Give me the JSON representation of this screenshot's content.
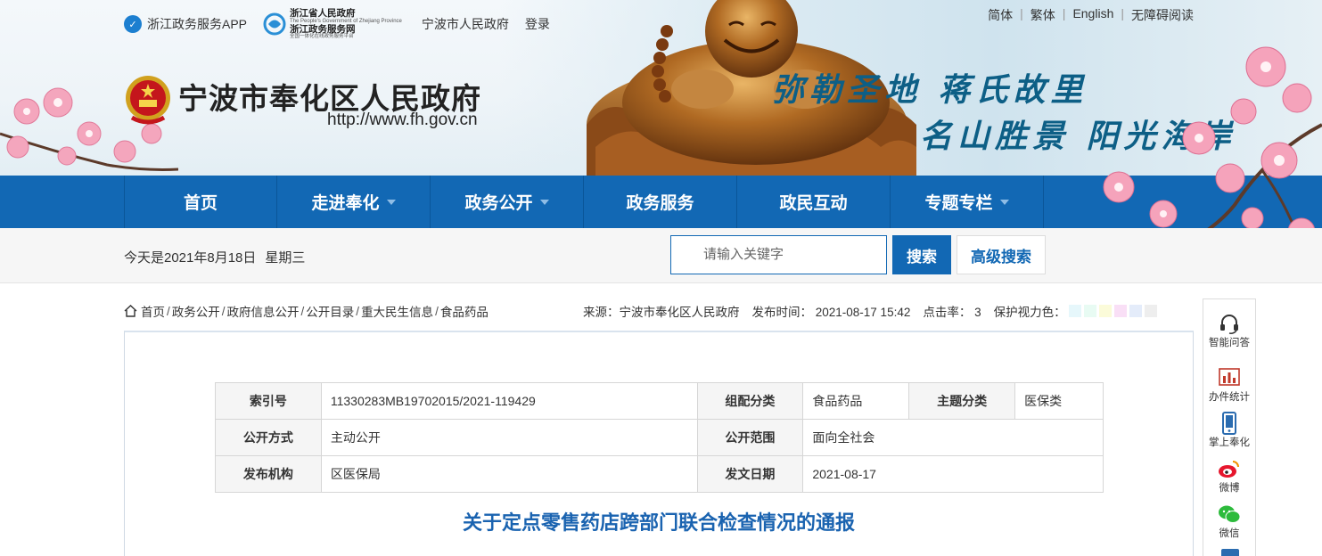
{
  "header": {
    "app_link": "浙江政务服务APP",
    "zw_logo": {
      "line1": "浙江省人民政府",
      "line2": "The People's Government of Zhejiang Province",
      "line3": "浙江政务服务网",
      "line4": "全国一体化在线政务服务平台"
    },
    "city_link": "宁波市人民政府",
    "login": "登录",
    "languages": [
      "简体",
      "繁体",
      "English",
      "无障碍阅读"
    ],
    "site_title": "宁波市奉化区人民政府",
    "site_url": "http://www.fh.gov.cn",
    "slogan_line1": "弥勒圣地  蒋氏故里",
    "slogan_line2": "名山胜景  阳光海岸"
  },
  "nav": {
    "items": [
      {
        "label": "首页",
        "has_menu": false
      },
      {
        "label": "走进奉化",
        "has_menu": true
      },
      {
        "label": "政务公开",
        "has_menu": true
      },
      {
        "label": "政务服务",
        "has_menu": false
      },
      {
        "label": "政民互动",
        "has_menu": false
      },
      {
        "label": "专题专栏",
        "has_menu": true
      }
    ]
  },
  "subbar": {
    "date": "今天是2021年8月18日",
    "weekday": "星期三",
    "search_placeholder": "请输入关键字",
    "search_button": "搜索",
    "advanced_button": "高级搜索"
  },
  "breadcrumb": [
    "首页",
    "政务公开",
    "政府信息公开",
    "公开目录",
    "重大民生信息",
    "食品药品"
  ],
  "meta": {
    "source": "来源：宁波市奉化区人民政府",
    "publish_time": "发布时间： 2021-08-17 15:42",
    "clicks": "点击率： 3",
    "eye_care": "保护视力色：",
    "swatch_colors": [
      "#e6f7fb",
      "#e8fbf3",
      "#fbfbd9",
      "#f9dff6",
      "#e4ecfa",
      "#eeeeee"
    ]
  },
  "info_table": {
    "index_label": "索引号",
    "index_value": "11330283MB19702015/2021-119429",
    "category_label": "组配分类",
    "category_value": "食品药品",
    "topic_label": "主题分类",
    "topic_value": "医保类",
    "mode_label": "公开方式",
    "mode_value": "主动公开",
    "scope_label": "公开范围",
    "scope_value": "面向全社会",
    "org_label": "发布机构",
    "org_value": "区医保局",
    "date_label": "发文日期",
    "date_value": "2021-08-17"
  },
  "document_title": "关于定点零售药店跨部门联合检查情况的通报",
  "float_bar": [
    "智能问答",
    "办件统计",
    "掌上奉化",
    "微博",
    "微信"
  ],
  "colors": {
    "nav_blue": "#1268b4",
    "title_blue": "#1a63b0",
    "slogan_blue": "#0d5f86"
  }
}
